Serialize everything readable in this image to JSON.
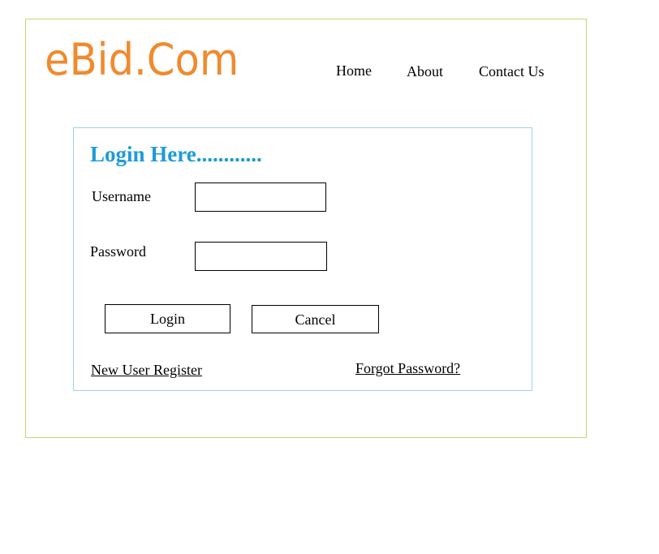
{
  "brand": {
    "logo_text": "eBid.Com",
    "logo_color": "#f08a2e"
  },
  "nav": {
    "items": [
      {
        "label": "Home"
      },
      {
        "label": "About"
      },
      {
        "label": "Contact Us"
      }
    ]
  },
  "login": {
    "heading": "Login Here............",
    "heading_color": "#1e9bd7",
    "username_label": "Username",
    "username_value": "",
    "password_label": "Password",
    "password_value": "",
    "login_button": "Login",
    "cancel_button": "Cancel",
    "register_link": "New User Register",
    "forgot_link": "Forgot Password?"
  }
}
